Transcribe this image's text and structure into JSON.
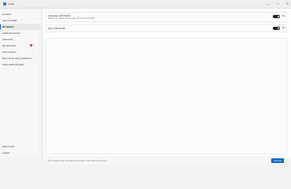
{
  "window": {
    "title": "Hdbp"
  },
  "sidebar": {
    "items": [
      {
        "label": "General"
      },
      {
        "label": "Input & Install"
      },
      {
        "label": "AV Switch"
      },
      {
        "label": "Audio Recording"
      },
      {
        "label": "Advanced"
      },
      {
        "label": "My Accounts"
      },
      {
        "label": "Add a device"
      },
      {
        "label": "Become an early participant"
      },
      {
        "label": "Share Web Activities"
      }
    ],
    "bottom_items": [
      {
        "label": "Help center"
      },
      {
        "label": "Logout"
      }
    ]
  },
  "main": {
    "settings": [
      {
        "title": "Automate OM Switch",
        "description": "Disable the default device setup from connected MSP",
        "toggle_label": "Off"
      },
      {
        "title": "Sync OM Switch",
        "description": "",
        "toggle_label": "Off"
      }
    ],
    "footer": {
      "message": "Select adapter type, generate secure token, share with remote peers",
      "button_label": "Generate"
    }
  },
  "colors": {
    "accent": "#0067c0",
    "badge": "#d13438"
  }
}
